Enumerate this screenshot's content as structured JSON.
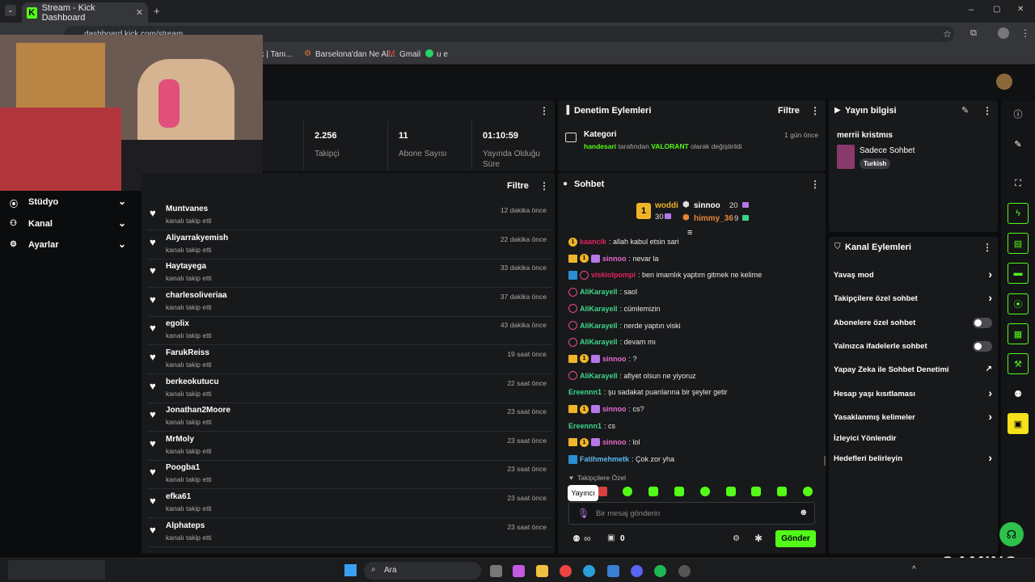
{
  "browser": {
    "tab_title": "Stream - Kick Dashboard",
    "url": "dashboard.kick.com/stream",
    "bookmarks": [
      "ük | Tanı...",
      "Barselona'dan Ne Al...",
      "Gmail",
      "u e"
    ]
  },
  "sidebar": {
    "items": [
      {
        "label": "Stüdyo"
      },
      {
        "label": "Kanal"
      },
      {
        "label": "Ayarlar"
      }
    ]
  },
  "stats": {
    "items": [
      {
        "value": "2.256",
        "label": "Takipçi"
      },
      {
        "value": "11",
        "label": "Abone Sayısı"
      },
      {
        "value": "01:10:59",
        "label": "Yayında Olduğu Süre"
      }
    ]
  },
  "activity": {
    "filter_label": "Filtre",
    "items": [
      {
        "name": "Muntvanes",
        "sub": "kanalı takip etti",
        "time": "12 dakika önce"
      },
      {
        "name": "Aliyarrakyemish",
        "sub": "kanalı takip etti",
        "time": "22 dakika önce"
      },
      {
        "name": "Haytayega",
        "sub": "kanalı takip etti",
        "time": "33 dakika önce"
      },
      {
        "name": "charlesoliveriaa",
        "sub": "kanalı takip etti",
        "time": "37 dakika önce"
      },
      {
        "name": "egolix",
        "sub": "kanalı takip etti",
        "time": "43 dakika önce"
      },
      {
        "name": "FarukReiss",
        "sub": "kanalı takip etti",
        "time": "19 saat önce"
      },
      {
        "name": "berkeokutucu",
        "sub": "kanalı takip etti",
        "time": "22 saat önce"
      },
      {
        "name": "Jonathan2Moore",
        "sub": "kanalı takip etti",
        "time": "23 saat önce"
      },
      {
        "name": "MrMoly",
        "sub": "kanalı takip etti",
        "time": "23 saat önce"
      },
      {
        "name": "Poogba1",
        "sub": "kanalı takip etti",
        "time": "23 saat önce"
      },
      {
        "name": "efka61",
        "sub": "kanalı takip etti",
        "time": "23 saat önce"
      },
      {
        "name": "Alphateps",
        "sub": "kanalı takip etti",
        "time": "23 saat önce"
      }
    ]
  },
  "moderation": {
    "title": "Denetim Eylemleri",
    "filter_label": "Filtre",
    "entry_title": "Kategori",
    "entry_user": "handesari",
    "entry_text1": "tarafından",
    "entry_game": "VALORANT",
    "entry_text2": "olarak değiştirildi",
    "entry_time": "1 gün önce"
  },
  "chat": {
    "title": "Sohbet",
    "leaderboard": {
      "first_name": "woddi",
      "first_count": "30",
      "second_name": "sinnoo",
      "second_count": "20",
      "third_name": "himmy_36",
      "third_count": "9"
    },
    "messages": [
      {
        "user": "kaancik",
        "text": ": allah kabul etsin sari",
        "color": "#e0245e"
      },
      {
        "user": "sinnoo",
        "text": ": nevar la",
        "color": "#e86ad0"
      },
      {
        "user": "viskiolpompi",
        "text": ": ben imamlık yaptım gitmek ne kelime",
        "color": "#e0245e"
      },
      {
        "user": "AliKarayell",
        "text": ": saol",
        "color": "#3cd68a"
      },
      {
        "user": "AliKarayell",
        "text": ": cümlemizin",
        "color": "#3cd68a"
      },
      {
        "user": "AliKarayell",
        "text": ": nerde yaptın viski",
        "color": "#3cd68a"
      },
      {
        "user": "AliKarayell",
        "text": ": devam mı",
        "color": "#3cd68a"
      },
      {
        "user": "sinnoo",
        "text": ": ?",
        "color": "#e86ad0"
      },
      {
        "user": "AliKarayell",
        "text": ": afiyet olsun ne yiyoruz",
        "color": "#3cd68a"
      },
      {
        "user": "Ereennn1",
        "text": ": şu sadakat puanlarına bir şeyler getir",
        "color": "#3cd68a"
      },
      {
        "user": "sinnoo",
        "text": ": cs?",
        "color": "#e86ad0"
      },
      {
        "user": "Ereennn1",
        "text": ": cs",
        "color": "#3cd68a"
      },
      {
        "user": "sinnoo",
        "text": ": lol",
        "color": "#e86ad0"
      },
      {
        "user": "Fatihmehmetk",
        "text": ": Çok zor yha",
        "color": "#5ab8f0"
      }
    ],
    "followers_only": "Takipçilere Özel",
    "tooltip": "Yayıncı",
    "input_placeholder": "Bir mesaj gönderin",
    "infinity": "∞",
    "points": "0",
    "send_label": "Gönder"
  },
  "stream_info": {
    "title": "Yayın bilgisi",
    "stream_title": "merrii kristmıs",
    "category": "Sadece Sohbet",
    "tag": "Turkish"
  },
  "channel_actions": {
    "title": "Kanal Eylemleri",
    "items": [
      {
        "label": "Yavaş mod",
        "control": "chevron"
      },
      {
        "label": "Takipçilere özel sohbet",
        "control": "chevron"
      },
      {
        "label": "Abonelere özel sohbet",
        "control": "toggle"
      },
      {
        "label": "Yalnızca ifadelerle sohbet",
        "control": "toggle"
      },
      {
        "label": "Yapay Zeka ile Sohbet Denetimi",
        "control": "external"
      },
      {
        "label": "Hesap yaşı kısıtlaması",
        "control": "chevron"
      },
      {
        "label": "Yasaklanmış kelimeler",
        "control": "chevron"
      },
      {
        "label": "İzleyici Yönlendir",
        "control": "none"
      },
      {
        "label": "Hedefleri belirleyin",
        "control": "chevron"
      }
    ]
  },
  "taskbar": {
    "search_label": "Ara"
  },
  "watermark": "GAMING",
  "colors": {
    "accent": "#53fc18",
    "panel": "#18191b",
    "bg": "#0b0c0d"
  }
}
